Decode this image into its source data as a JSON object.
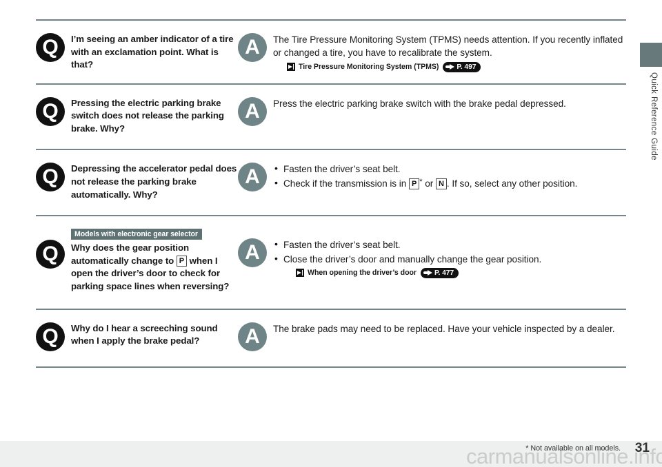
{
  "sidebar": {
    "section_label": "Quick Reference Guide"
  },
  "footer": {
    "footnote": "* Not available on all models.",
    "page_number": "31",
    "watermark": "carmanualsonline.info"
  },
  "labels": {
    "q_badge": "Q",
    "a_badge": "A"
  },
  "colors": {
    "rule": "#6f8285",
    "q_badge_bg": "#111111",
    "a_badge_bg": "#6f8486",
    "model_note_bg": "#5e7173",
    "side_tab": "#67797b",
    "footer_band": "#eef0ef"
  },
  "qa": [
    {
      "question": "I’m seeing an amber indicator of a tire with an exclamation point. What is that?",
      "answer": "The Tire Pressure Monitoring System (TPMS) needs attention. If you recently inflated or changed a tire, you have to recalibrate the system.",
      "reference": {
        "text": "Tire Pressure Monitoring System (TPMS)",
        "page": "P. 497"
      }
    },
    {
      "question": "Pressing the electric parking brake switch does not release the parking brake. Why?",
      "answer": "Press the electric parking brake switch with the brake pedal depressed."
    },
    {
      "question": "Depressing the accelerator pedal does not release the parking brake automatically. Why?",
      "bullets": [
        "Fasten the driver’s seat belt.",
        "Check if the transmission is in  P * or  N . If so, select any other position."
      ],
      "bullet1": "Fasten the driver’s seat belt.",
      "bullet2_a": "Check if the transmission is in",
      "bullet2_gear1": "P",
      "bullet2_star": "*",
      "bullet2_b": "or",
      "bullet2_gear2": "N",
      "bullet2_c": ". If so, select any other position."
    },
    {
      "model_note": "Models with electronic gear selector",
      "question_a": "Why does the gear position automatically change to",
      "question_gear": "P",
      "question_b": "when I open the driver’s door to check for parking space lines when reversing?",
      "bullet1": "Fasten the driver’s seat belt.",
      "bullet2": "Close the driver’s door and manually change the gear position.",
      "reference": {
        "text": "When opening the driver’s door",
        "page": "P. 477"
      }
    },
    {
      "question": "Why do I hear a screeching sound when I apply the brake pedal?",
      "answer": "The brake pads may need to be replaced. Have your vehicle inspected by a dealer."
    }
  ]
}
